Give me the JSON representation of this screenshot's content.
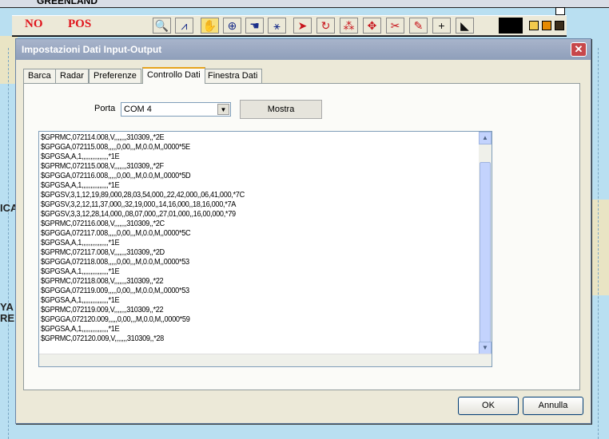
{
  "map": {
    "label_top": "GREENLAND",
    "label_left_1": "ICA",
    "label_left_2": "YA",
    "label_left_3": "RE"
  },
  "toolbar": {
    "status_no": "NO",
    "status_pos": "POS",
    "tools": [
      {
        "icon": "zoom-icon",
        "glyph": "🔍"
      },
      {
        "icon": "compass-icon",
        "glyph": "⩘"
      },
      {
        "icon": "hand-icon",
        "glyph": "✋"
      },
      {
        "icon": "crosshair-icon",
        "glyph": "⊕"
      },
      {
        "icon": "pan-hand-icon",
        "glyph": "☚"
      },
      {
        "icon": "route-icon",
        "glyph": "⚹"
      },
      {
        "icon": "pointer-icon",
        "glyph": "➤"
      },
      {
        "icon": "rotate-icon",
        "glyph": "↻"
      },
      {
        "icon": "waypoint-icon",
        "glyph": "⁂"
      },
      {
        "icon": "move-icon",
        "glyph": "✥"
      },
      {
        "icon": "cut-icon",
        "glyph": "✂"
      },
      {
        "icon": "pencil-icon",
        "glyph": "✎"
      },
      {
        "icon": "plus-icon",
        "glyph": "+"
      },
      {
        "icon": "profile-icon",
        "glyph": "◣"
      }
    ]
  },
  "dialog": {
    "title": "Impostazioni Dati Input-Output",
    "close_glyph": "✕",
    "tabs": [
      "Barca",
      "Radar",
      "Preferenze",
      "Controllo Dati",
      "Finestra Dati"
    ],
    "active_tab": "Controllo Dati",
    "porta_label": "Porta",
    "porta_value": "COM 4",
    "mostra_label": "Mostra",
    "log_lines": [
      "$GPRMC,072114.008,V,,,,,,,310309,,*2E",
      "$GPGGA,072115.008,,,,,0,00,,,M,0.0,M,,0000*5E",
      "$GPGSA,A,1,,,,,,,,,,,,,,,*1E",
      "$GPRMC,072115.008,V,,,,,,,310309,,*2F",
      "$GPGGA,072116.008,,,,,0,00,,,M,0.0,M,,0000*5D",
      "$GPGSA,A,1,,,,,,,,,,,,,,,*1E",
      "$GPGSV,3,1,12,19,89,000,28,03,54,000,,22,42,000,,06,41,000,*7C",
      "$GPGSV,3,2,12,11,37,000,,32,19,000,,14,16,000,,18,16,000,*7A",
      "$GPGSV,3,3,12,28,14,000,,08,07,000,,27,01,000,,16,00,000,*79",
      "$GPRMC,072116.008,V,,,,,,,310309,,*2C",
      "$GPGGA,072117.008,,,,,0,00,,,M,0.0,M,,0000*5C",
      "$GPGSA,A,1,,,,,,,,,,,,,,,*1E",
      "$GPRMC,072117.008,V,,,,,,,310309,,*2D",
      "$GPGGA,072118.008,,,,,0,00,,,M,0.0,M,,0000*53",
      "$GPGSA,A,1,,,,,,,,,,,,,,,*1E",
      "$GPRMC,072118.008,V,,,,,,,310309,,*22",
      "$GPGGA,072119.009,,,,,0,00,,,M,0.0,M,,0000*53",
      "$GPGSA,A,1,,,,,,,,,,,,,,,*1E",
      "$GPRMC,072119.009,V,,,,,,,310309,,*22",
      "$GPGGA,072120.009,,,,,0,00,,,M,0.0,M,,0000*59",
      "$GPGSA,A,1,,,,,,,,,,,,,,,*1E",
      "$GPRMC,072120.009,V,,,,,,,310309,,*28"
    ],
    "ok_label": "OK",
    "cancel_label": "Annulla"
  }
}
